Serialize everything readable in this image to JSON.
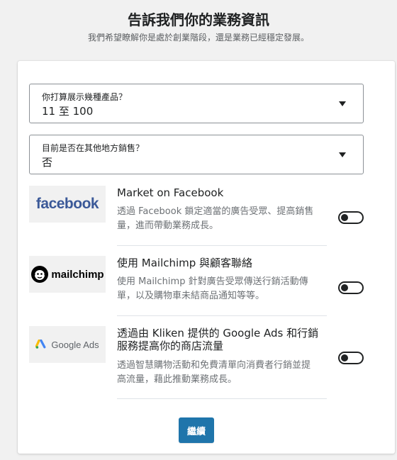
{
  "header": {
    "title": "告訴我們你的業務資訊",
    "subtitle": "我們希望瞭解你是處於創業階段，還是業務已經穩定發展。"
  },
  "form": {
    "products_select": {
      "label": "你打算展示幾種產品？",
      "value": "11 至 100"
    },
    "other_sales_select": {
      "label": "目前是否在其他地方銷售？",
      "value": "否"
    }
  },
  "integrations": [
    {
      "logo_text": "facebook",
      "logo_icon": "facebook-logo",
      "title": "Market on Facebook",
      "desc_line1": "透過 Facebook 鎖定適當的廣告受眾、提高銷售",
      "desc_line2": "量，進而帶動業務成長。",
      "enabled": false
    },
    {
      "logo_text": "mailchimp",
      "logo_icon": "mailchimp-logo",
      "title": "使用 Mailchimp 與顧客聯絡",
      "desc_line1": "使用 Mailchimp 針對廣告受眾傳送行銷活動傳",
      "desc_line2": "單，以及購物車未結商品通知等等。",
      "enabled": false
    },
    {
      "logo_text": "Google Ads",
      "logo_icon": "google-ads-logo",
      "title_line1": "透過由 Kliken 提供的 Google Ads 和行銷",
      "title_line2": "服務提高你的商店流量",
      "desc_line1": "透過智慧購物活動和免費清單向消費者行銷並提",
      "desc_line2": "高流量，藉此推動業務成長。",
      "enabled": false
    }
  ],
  "actions": {
    "continue_label": "繼續"
  },
  "colors": {
    "primary": "#1f75ab",
    "facebook": "#3b5998",
    "background": "#f1f1f1"
  }
}
